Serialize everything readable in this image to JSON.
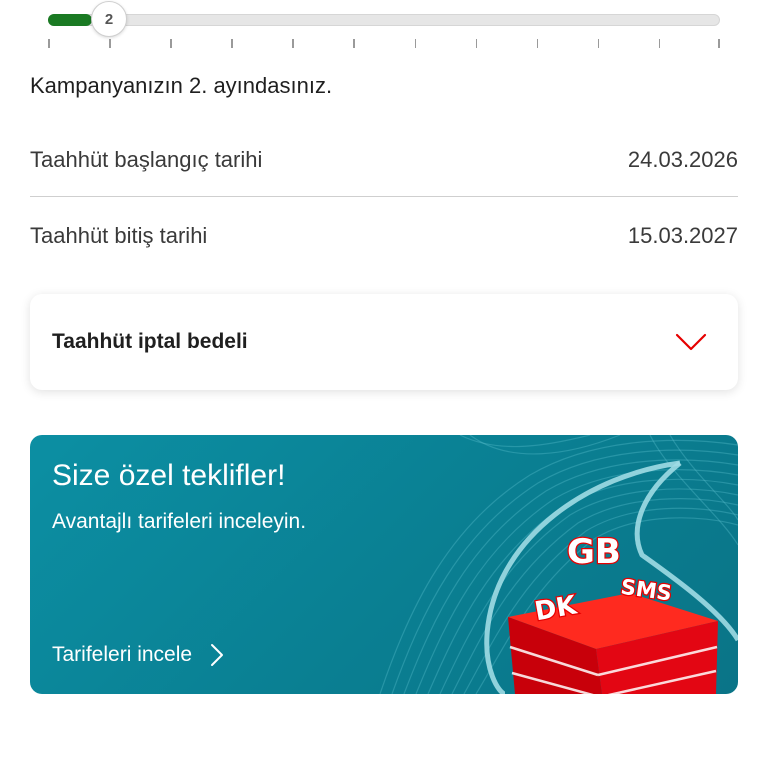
{
  "progress": {
    "current_step": "2",
    "total_ticks": 12,
    "fill_fraction": 0.065
  },
  "campaign": {
    "message": "Kampanyanızın 2. ayındasınız."
  },
  "commitment": {
    "start_label": "Taahhüt başlangıç tarihi",
    "start_value": "24.03.2026",
    "end_label": "Taahhüt bitiş tarihi",
    "end_value": "15.03.2027"
  },
  "accordion": {
    "title": "Taahhüt iptal bedeli",
    "icon": "chevron-down-icon"
  },
  "promo": {
    "title": "Size özel teklifler!",
    "subtitle": "Avantajlı tarifeleri inceleyin.",
    "link_label": "Tarifeleri incele",
    "link_icon": "chevron-right-icon",
    "art_labels": {
      "gb": "GB",
      "dk": "DK",
      "sms": "SMS"
    }
  },
  "colors": {
    "progress_fill": "#1a7a23",
    "accent_red": "#e60000",
    "promo_bg": "#0a8497"
  }
}
